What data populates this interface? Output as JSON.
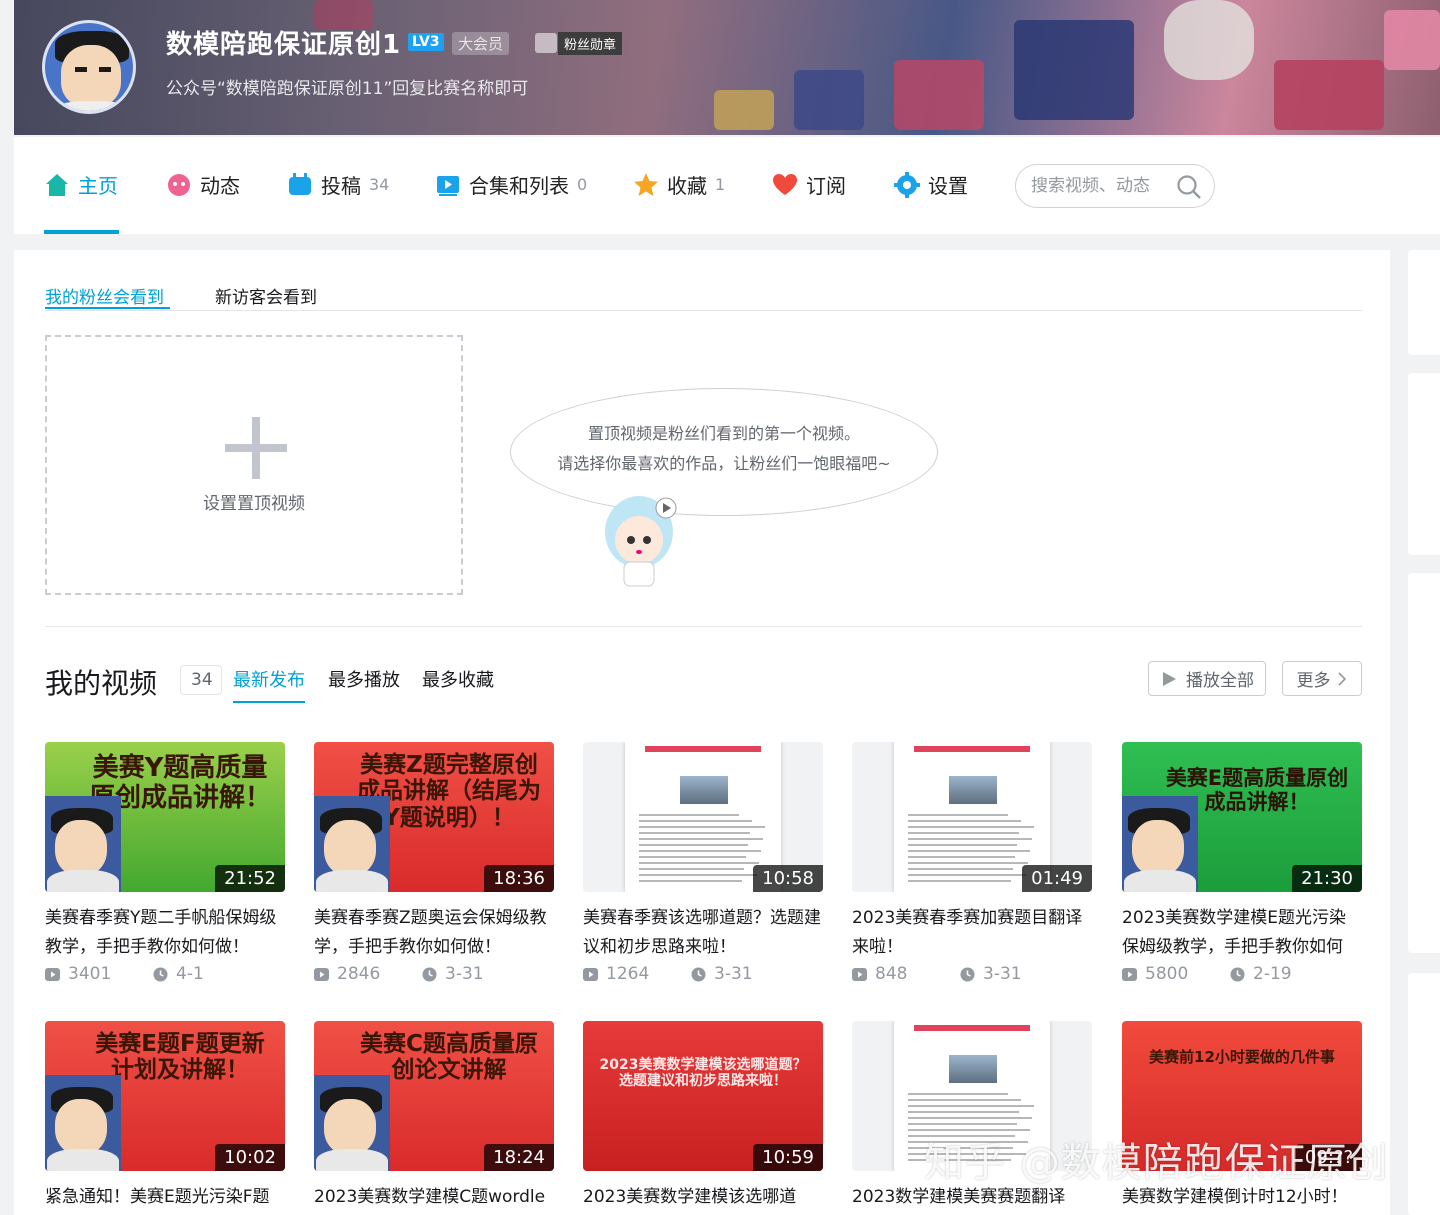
{
  "header": {
    "username": "数模陪跑保证原创1",
    "level": "LV3",
    "vip": "大会员",
    "fan_badge": "粉丝勋章",
    "sign": "公众号“数模陪跑保证原创11”回复比赛名称即可"
  },
  "nav": {
    "items": [
      {
        "label": "主页",
        "count": ""
      },
      {
        "label": "动态",
        "count": ""
      },
      {
        "label": "投稿",
        "count": "34"
      },
      {
        "label": "合集和列表",
        "count": "0"
      },
      {
        "label": "收藏",
        "count": "1"
      },
      {
        "label": "订阅",
        "count": ""
      },
      {
        "label": "设置",
        "count": ""
      }
    ],
    "active": "主页",
    "search_placeholder": "搜索视频、动态"
  },
  "pin_section": {
    "tabs": [
      "我的粉丝会看到",
      "新访客会看到"
    ],
    "add_label": "设置置顶视频",
    "bubble_line1": "置顶视频是粉丝们看到的第一个视频。",
    "bubble_line2": "请选择你最喜欢的作品，让粉丝们一饱眼福吧~"
  },
  "videos_section": {
    "title": "我的视频",
    "count": "34",
    "sort_tabs": [
      "最新发布",
      "最多播放",
      "最多收藏"
    ],
    "play_all": "播放全部",
    "more": "更多"
  },
  "videos": [
    {
      "thumb_text": "美赛Y题高质量原创成品讲解！",
      "thumb_style": "green",
      "duration": "21:52",
      "title": "美赛春季赛Y题二手帆船保姆级教学，手把手教你如何做！",
      "plays": "3401",
      "date": "4-1"
    },
    {
      "thumb_text": "美赛Z题完整原创成品讲解（结尾为Y题说明）！",
      "thumb_style": "red",
      "duration": "18:36",
      "title": "美赛春季赛Z题奥运会保姆级教学，手把手教你如何做！",
      "plays": "2846",
      "date": "3-31"
    },
    {
      "thumb_text": "",
      "thumb_style": "doc",
      "duration": "10:58",
      "title": "美赛春季赛该选哪道题？选题建议和初步思路来啦！",
      "plays": "1264",
      "date": "3-31"
    },
    {
      "thumb_text": "",
      "thumb_style": "doc",
      "duration": "01:49",
      "title": "2023美赛春季赛加赛题目翻译来啦！",
      "plays": "848",
      "date": "3-31"
    },
    {
      "thumb_text": "美赛E题高质量原创成品讲解！",
      "thumb_style": "green2",
      "duration": "21:30",
      "title": "2023美赛数学建模E题光污染保姆级教学，手把手教你如何",
      "plays": "5800",
      "date": "2-19"
    },
    {
      "thumb_text": "美赛E题F题更新计划及讲解！",
      "thumb_style": "red",
      "duration": "10:02",
      "title": "紧急通知！美赛E题光污染F题",
      "plays": "",
      "date": ""
    },
    {
      "thumb_text": "美赛C题高质量原创论文讲解",
      "thumb_style": "red",
      "duration": "18:24",
      "title": "2023美赛数学建模C题wordle",
      "plays": "",
      "date": ""
    },
    {
      "thumb_text": "2023美赛数学建模该选哪道题？ 选题建议和初步思路来啦！",
      "thumb_style": "redsmall",
      "duration": "10:59",
      "title": "2023美赛数学建模该选哪道",
      "plays": "",
      "date": ""
    },
    {
      "thumb_text": "",
      "thumb_style": "doc",
      "duration": "",
      "title": "2023数学建模美赛赛题翻译",
      "plays": "",
      "date": ""
    },
    {
      "thumb_text": "美赛前12小时要做的几件事",
      "thumb_style": "redsmall2",
      "duration": "09:??",
      "title": "美赛数学建模倒计时12小时！",
      "plays": "",
      "date": ""
    }
  ],
  "watermark": "知乎 @数模陪跑保证原创"
}
